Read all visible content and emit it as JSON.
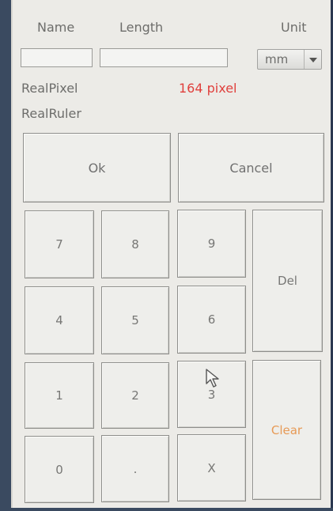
{
  "header": {
    "name_label": "Name",
    "length_label": "Length",
    "unit_label": "Unit"
  },
  "inputs": {
    "name_value": "",
    "length_value": ""
  },
  "unit_select": {
    "selected": "mm"
  },
  "info": {
    "real_pixel_label": "RealPixel",
    "real_pixel_value": "164 pixel",
    "real_ruler_label": "RealRuler"
  },
  "actions": {
    "ok": "Ok",
    "cancel": "Cancel"
  },
  "keypad": {
    "k7": "7",
    "k8": "8",
    "k9": "9",
    "k4": "4",
    "k5": "5",
    "k6": "6",
    "k1": "1",
    "k2": "2",
    "k3": "3",
    "k0": "0",
    "dot": ".",
    "x": "X",
    "del": "Del",
    "clear": "Clear"
  },
  "colors": {
    "pixel_value": "#e0403d",
    "clear_text": "#e79a56"
  }
}
